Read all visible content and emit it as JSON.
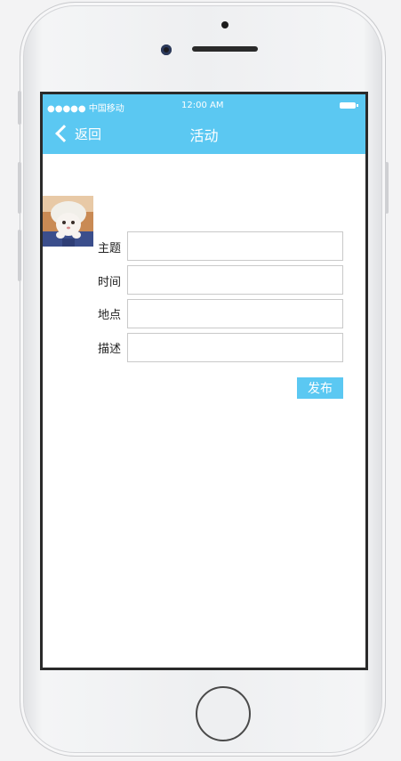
{
  "status_bar": {
    "carrier": "●●●●● 中国移动",
    "time": "12:00 AM"
  },
  "nav": {
    "back_label": "返回",
    "title": "活动"
  },
  "form": {
    "subject_label": "主题",
    "subject_value": "",
    "time_label": "时间",
    "time_value": "",
    "location_label": "地点",
    "location_value": "",
    "description_label": "描述",
    "description_value": ""
  },
  "actions": {
    "publish_label": "发布"
  },
  "colors": {
    "accent": "#5bc8f2",
    "screen_bg": "#ffffff"
  },
  "icons": {
    "back": "chevron-left-icon",
    "battery": "battery-icon",
    "avatar": "avatar-image"
  }
}
